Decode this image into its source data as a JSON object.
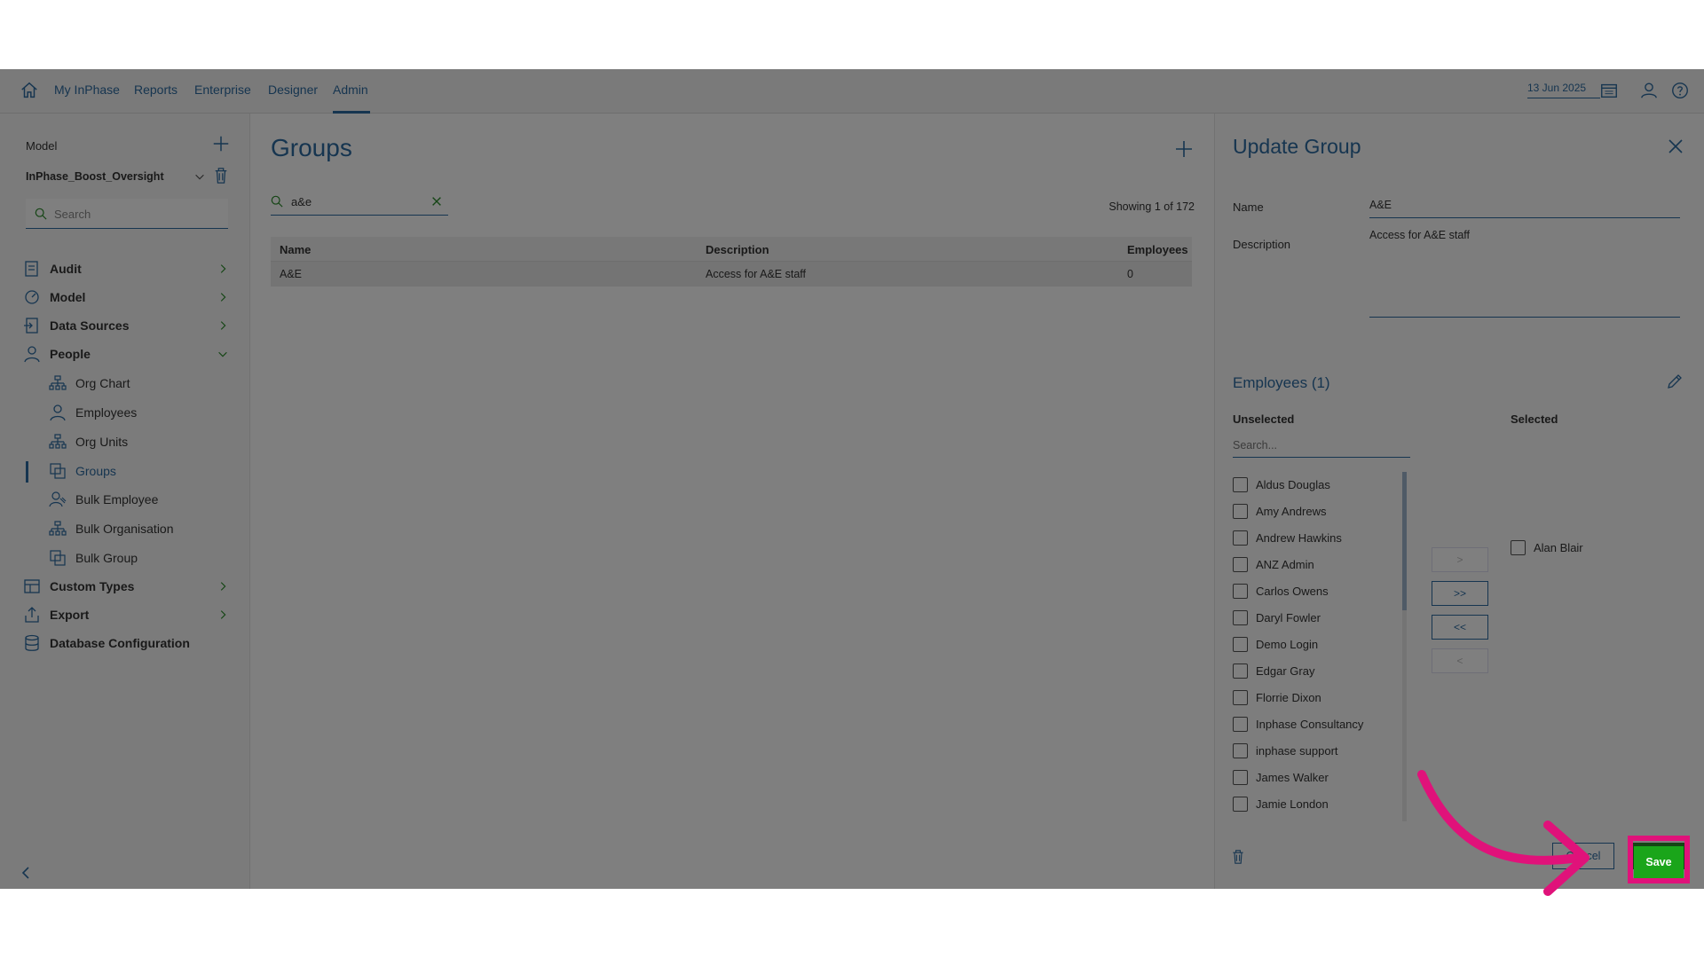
{
  "nav": {
    "items": [
      {
        "label": "My InPhase"
      },
      {
        "label": "Reports"
      },
      {
        "label": "Enterprise"
      },
      {
        "label": "Designer"
      },
      {
        "label": "Admin"
      }
    ],
    "date": "13 Jun 2025",
    "icons": [
      "home-icon",
      "calendar-icon",
      "user-icon",
      "help-icon"
    ]
  },
  "sidebar": {
    "model_label": "Model",
    "model_value": "InPhase_Boost_Oversight",
    "search_placeholder": "Search",
    "items": [
      {
        "label": "Audit",
        "icon": "audit-icon"
      },
      {
        "label": "Model",
        "icon": "model-icon"
      },
      {
        "label": "Data Sources",
        "icon": "data-sources-icon"
      },
      {
        "label": "People",
        "icon": "person-icon"
      },
      {
        "label": "Custom Types",
        "icon": "custom-types-icon"
      },
      {
        "label": "Export",
        "icon": "export-icon"
      },
      {
        "label": "Database Configuration",
        "icon": "database-icon"
      }
    ],
    "people_sub": [
      {
        "label": "Org Chart",
        "icon": "org-chart-icon"
      },
      {
        "label": "Employees",
        "icon": "person-icon"
      },
      {
        "label": "Org Units",
        "icon": "org-chart-icon"
      },
      {
        "label": "Groups",
        "icon": "groups-icon"
      },
      {
        "label": "Bulk Employee",
        "icon": "bulk-employee-icon"
      },
      {
        "label": "Bulk Organisation",
        "icon": "org-chart-icon"
      },
      {
        "label": "Bulk Group",
        "icon": "groups-icon"
      }
    ]
  },
  "main": {
    "title": "Groups",
    "search_value": "a&e",
    "showing": "Showing 1 of 172",
    "columns": [
      "Name",
      "Description",
      "Employees"
    ],
    "rows": [
      {
        "name": "A&E",
        "description": "Access for A&E staff",
        "employees": "0"
      }
    ]
  },
  "panel": {
    "title": "Update Group",
    "name_label": "Name",
    "name_value": "A&E",
    "description_label": "Description",
    "description_value": "Access for A&E staff",
    "employees_title": "Employees (1)",
    "unselected_label": "Unselected",
    "selected_label": "Selected",
    "search_placeholder": "Search...",
    "unselected": [
      "Aldus Douglas",
      "Amy Andrews",
      "Andrew Hawkins",
      "ANZ Admin",
      "Carlos Owens",
      "Daryl Fowler",
      "Demo Login",
      "Edgar Gray",
      "Florrie Dixon",
      "Inphase Consultancy",
      "inphase support",
      "James Walker",
      "Jamie London"
    ],
    "selected": [
      "Alan Blair"
    ],
    "move_buttons": [
      ">",
      ">>",
      "<<",
      "<"
    ],
    "cancel_label": "Cancel",
    "save_label": "Save"
  },
  "colors": {
    "accent": "#2c6aa0",
    "save": "#2b8a2b",
    "highlight": "#e0127a"
  }
}
